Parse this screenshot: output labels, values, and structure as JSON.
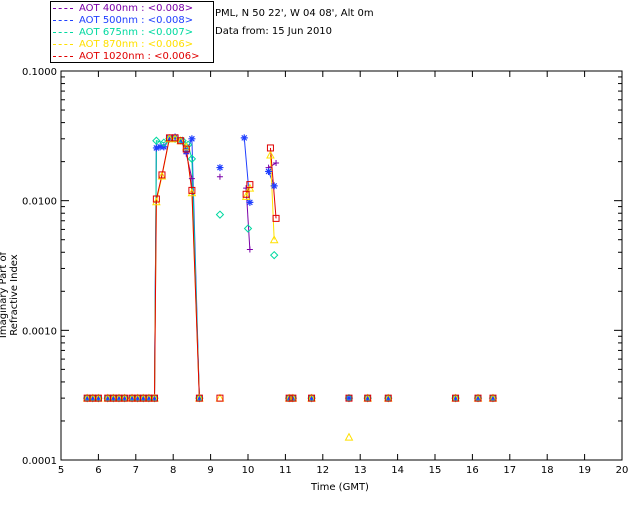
{
  "header": {
    "site": "PML, N 50 22', W 04 08', Alt 0m",
    "date": "Data from: 15 Jun 2010"
  },
  "legend": [
    {
      "label": "AOT  400nm : <0.008>",
      "color": "#7b00a8"
    },
    {
      "label": "AOT  500nm : <0.008>",
      "color": "#1f3fff"
    },
    {
      "label": "AOT  675nm : <0.007>",
      "color": "#00d9a0"
    },
    {
      "label": "AOT  870nm : <0.006>",
      "color": "#ffe000"
    },
    {
      "label": "AOT 1020nm : <0.006>",
      "color": "#e00000"
    }
  ],
  "chart_data": {
    "type": "scatter",
    "xlabel": "Time (GMT)",
    "ylabel": "Imaginary Part of Refractive Index",
    "xlim": [
      5,
      20
    ],
    "ylim": [
      0.0001,
      0.1
    ],
    "y_scale": "log",
    "x_ticks": [
      5,
      6,
      7,
      8,
      9,
      10,
      11,
      12,
      13,
      14,
      15,
      16,
      17,
      18,
      19,
      20
    ],
    "y_ticks": [
      "0.0001",
      "0.0010",
      "0.0100",
      "0.1000"
    ],
    "grid": false,
    "series": [
      {
        "name": "AOT  400nm : <0.008>",
        "marker": "+",
        "color": "#7b00a8",
        "points": [
          [
            5.7,
            0.0003
          ],
          [
            5.85,
            0.0003
          ],
          [
            6.0,
            0.0003
          ],
          [
            6.25,
            0.0003
          ],
          [
            6.4,
            0.0003
          ],
          [
            6.55,
            0.0003
          ],
          [
            6.7,
            0.0003
          ],
          [
            6.9,
            0.0003
          ],
          [
            7.05,
            0.0003
          ],
          [
            7.2,
            0.0003
          ],
          [
            7.35,
            0.0003
          ],
          [
            7.5,
            0.0003
          ],
          [
            7.55,
            0.0255
          ],
          [
            7.75,
            0.026
          ],
          [
            7.9,
            0.0305
          ],
          [
            8.05,
            0.031
          ],
          [
            8.25,
            0.0285
          ],
          [
            8.35,
            0.023
          ],
          [
            8.5,
            0.0148
          ],
          [
            8.7,
            0.0003
          ],
          [
            9.25,
            0.0153
          ],
          [
            9.95,
            0.0125
          ],
          [
            10.05,
            0.0042
          ],
          [
            10.55,
            0.018
          ],
          [
            10.75,
            0.0195
          ],
          [
            11.1,
            0.0003
          ],
          [
            11.2,
            0.0003
          ],
          [
            11.7,
            0.0003
          ],
          [
            12.7,
            0.0003
          ],
          [
            13.2,
            0.0003
          ],
          [
            13.75,
            0.0003
          ],
          [
            15.55,
            0.0003
          ],
          [
            16.15,
            0.0003
          ],
          [
            16.55,
            0.0003
          ]
        ]
      },
      {
        "name": "AOT  500nm : <0.008>",
        "marker": "*",
        "color": "#1f3fff",
        "points": [
          [
            5.7,
            0.0003
          ],
          [
            5.85,
            0.0003
          ],
          [
            6.0,
            0.0003
          ],
          [
            6.25,
            0.0003
          ],
          [
            6.4,
            0.0003
          ],
          [
            6.55,
            0.0003
          ],
          [
            6.7,
            0.0003
          ],
          [
            6.9,
            0.0003
          ],
          [
            7.05,
            0.0003
          ],
          [
            7.2,
            0.0003
          ],
          [
            7.35,
            0.0003
          ],
          [
            7.5,
            0.0003
          ],
          [
            7.55,
            0.0255
          ],
          [
            7.65,
            0.026
          ],
          [
            7.75,
            0.026
          ],
          [
            7.9,
            0.0305
          ],
          [
            8.05,
            0.031
          ],
          [
            8.2,
            0.029
          ],
          [
            8.35,
            0.024
          ],
          [
            8.5,
            0.03
          ],
          [
            8.7,
            0.0003
          ],
          [
            9.25,
            0.018
          ],
          [
            9.9,
            0.0305
          ],
          [
            10.05,
            0.0097
          ],
          [
            10.55,
            0.0168
          ],
          [
            10.7,
            0.013
          ],
          [
            11.1,
            0.0003
          ],
          [
            11.2,
            0.0003
          ],
          [
            11.7,
            0.0003
          ],
          [
            12.7,
            0.0003
          ],
          [
            13.2,
            0.0003
          ],
          [
            13.75,
            0.0003
          ],
          [
            15.55,
            0.0003
          ],
          [
            16.15,
            0.0003
          ],
          [
            16.55,
            0.0003
          ]
        ]
      },
      {
        "name": "AOT  675nm : <0.007>",
        "marker": "diamond",
        "color": "#00d9a0",
        "points": [
          [
            5.7,
            0.0003
          ],
          [
            5.85,
            0.0003
          ],
          [
            6.0,
            0.0003
          ],
          [
            6.25,
            0.0003
          ],
          [
            6.4,
            0.0003
          ],
          [
            6.55,
            0.0003
          ],
          [
            6.7,
            0.0003
          ],
          [
            6.9,
            0.0003
          ],
          [
            7.05,
            0.0003
          ],
          [
            7.2,
            0.0003
          ],
          [
            7.35,
            0.0003
          ],
          [
            7.5,
            0.0003
          ],
          [
            7.55,
            0.029
          ],
          [
            7.75,
            0.028
          ],
          [
            7.9,
            0.03
          ],
          [
            8.05,
            0.03
          ],
          [
            8.25,
            0.029
          ],
          [
            8.4,
            0.027
          ],
          [
            8.5,
            0.021
          ],
          [
            8.7,
            0.0003
          ],
          [
            9.25,
            0.0078
          ],
          [
            10.0,
            0.0061
          ],
          [
            10.7,
            0.0038
          ],
          [
            11.1,
            0.0003
          ],
          [
            11.2,
            0.0003
          ],
          [
            11.7,
            0.0003
          ],
          [
            12.7,
            0.0003
          ],
          [
            13.2,
            0.0003
          ],
          [
            13.75,
            0.0003
          ],
          [
            15.55,
            0.0003
          ],
          [
            16.15,
            0.0003
          ],
          [
            16.55,
            0.0003
          ]
        ]
      },
      {
        "name": "AOT  870nm : <0.006>",
        "marker": "triangle",
        "color": "#ffe000",
        "points": [
          [
            5.7,
            0.0003
          ],
          [
            5.85,
            0.0003
          ],
          [
            6.0,
            0.0003
          ],
          [
            6.25,
            0.0003
          ],
          [
            6.4,
            0.0003
          ],
          [
            6.55,
            0.0003
          ],
          [
            6.7,
            0.0003
          ],
          [
            6.9,
            0.0003
          ],
          [
            7.05,
            0.0003
          ],
          [
            7.2,
            0.0003
          ],
          [
            7.35,
            0.0003
          ],
          [
            7.5,
            0.0003
          ],
          [
            7.55,
            0.0098
          ],
          [
            7.7,
            0.0155
          ],
          [
            7.9,
            0.03
          ],
          [
            8.05,
            0.03
          ],
          [
            8.2,
            0.029
          ],
          [
            8.35,
            0.026
          ],
          [
            8.5,
            0.0115
          ],
          [
            8.7,
            0.0003
          ],
          [
            9.25,
            0.0003
          ],
          [
            9.95,
            0.0108
          ],
          [
            10.05,
            0.0125
          ],
          [
            10.6,
            0.0225
          ],
          [
            10.7,
            0.005
          ],
          [
            11.1,
            0.0003
          ],
          [
            11.2,
            0.0003
          ],
          [
            11.7,
            0.0003
          ],
          [
            12.7,
            0.00015
          ],
          [
            13.2,
            0.0003
          ],
          [
            13.75,
            0.0003
          ],
          [
            15.55,
            0.0003
          ],
          [
            16.15,
            0.0003
          ],
          [
            16.55,
            0.0003
          ]
        ]
      },
      {
        "name": "AOT 1020nm : <0.006>",
        "marker": "square",
        "color": "#e00000",
        "points": [
          [
            5.7,
            0.0003
          ],
          [
            5.85,
            0.0003
          ],
          [
            6.0,
            0.0003
          ],
          [
            6.25,
            0.0003
          ],
          [
            6.4,
            0.0003
          ],
          [
            6.55,
            0.0003
          ],
          [
            6.7,
            0.0003
          ],
          [
            6.9,
            0.0003
          ],
          [
            7.05,
            0.0003
          ],
          [
            7.2,
            0.0003
          ],
          [
            7.35,
            0.0003
          ],
          [
            7.5,
            0.0003
          ],
          [
            7.55,
            0.0103
          ],
          [
            7.7,
            0.0158
          ],
          [
            7.9,
            0.0305
          ],
          [
            8.05,
            0.0305
          ],
          [
            8.2,
            0.029
          ],
          [
            8.35,
            0.025
          ],
          [
            8.5,
            0.012
          ],
          [
            8.7,
            0.0003
          ],
          [
            9.25,
            0.0003
          ],
          [
            9.95,
            0.0112
          ],
          [
            10.05,
            0.0133
          ],
          [
            10.6,
            0.0255
          ],
          [
            10.75,
            0.0073
          ],
          [
            11.1,
            0.0003
          ],
          [
            11.2,
            0.0003
          ],
          [
            11.7,
            0.0003
          ],
          [
            12.7,
            0.0003
          ],
          [
            13.2,
            0.0003
          ],
          [
            13.75,
            0.0003
          ],
          [
            15.55,
            0.0003
          ],
          [
            16.15,
            0.0003
          ],
          [
            16.55,
            0.0003
          ]
        ]
      }
    ],
    "segments": [
      [
        7.45,
        8.75
      ],
      [
        9.85,
        10.1
      ],
      [
        10.5,
        10.8
      ]
    ]
  }
}
